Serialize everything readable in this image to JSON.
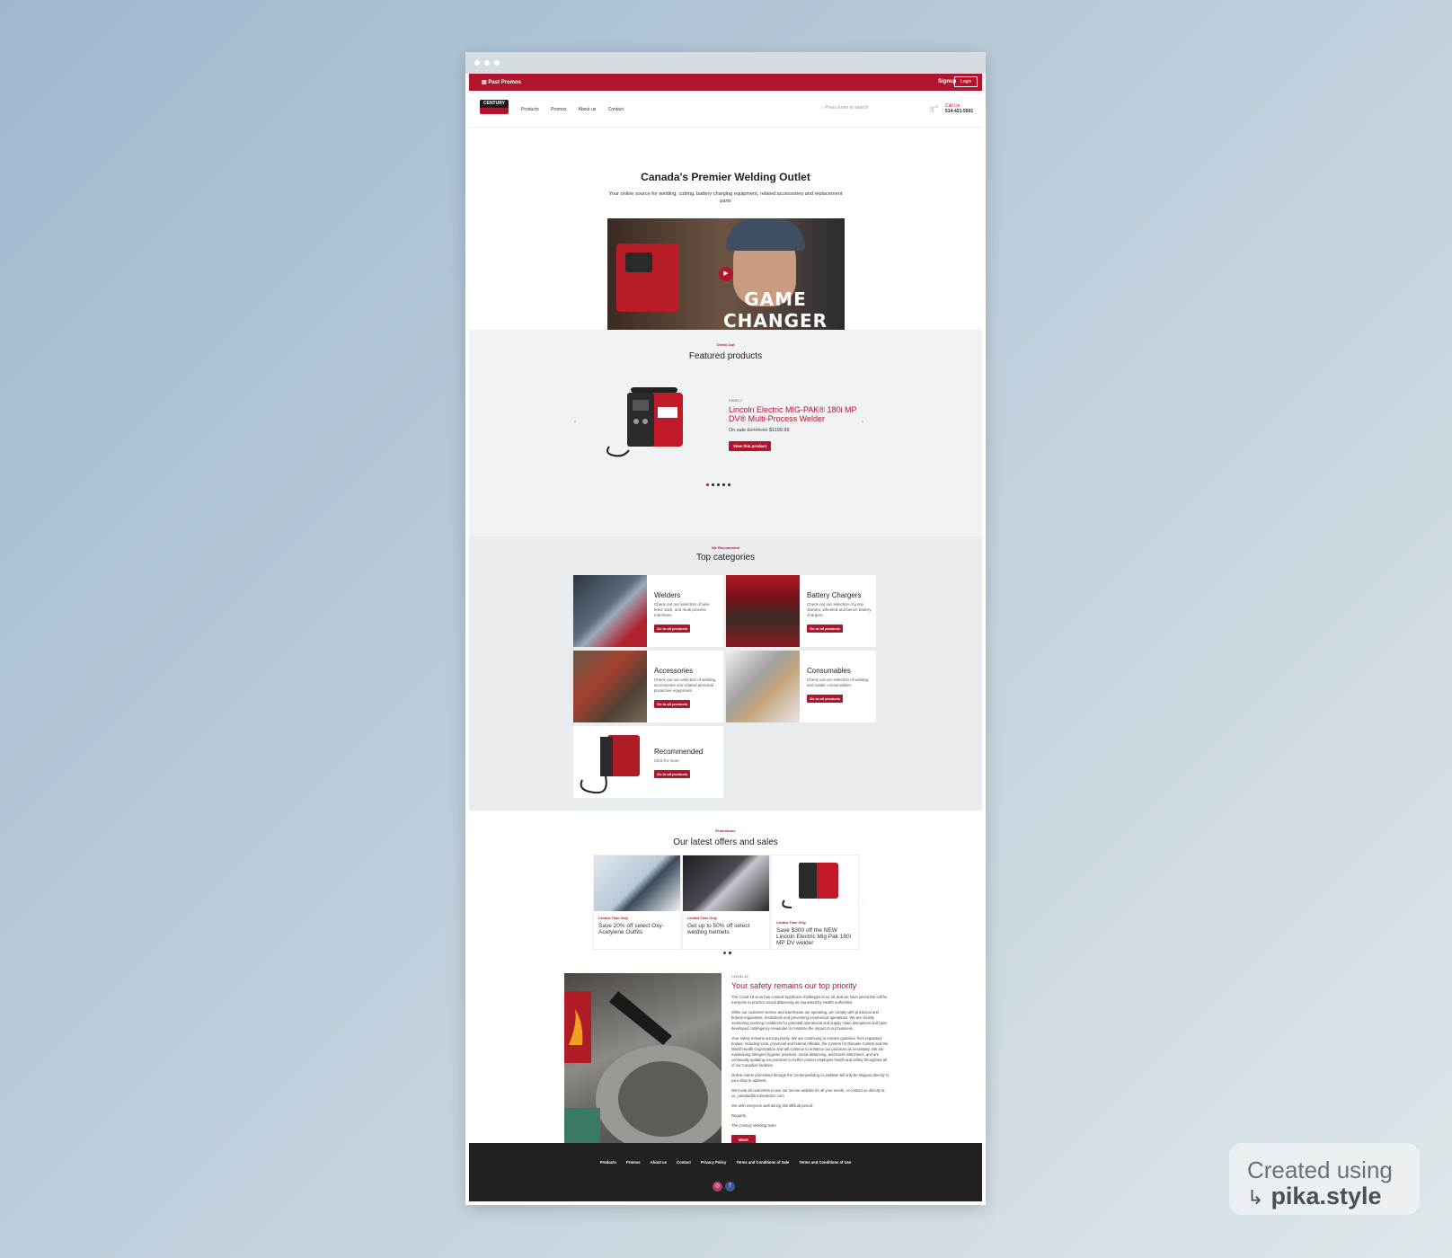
{
  "topbar": {
    "promo": "Past Promos",
    "signup": "Signup",
    "login": "Login"
  },
  "nav": {
    "links": [
      "Products",
      "Promos",
      "About us",
      "Contact"
    ],
    "search_placeholder": "Press Enter to search",
    "cart_count": "0",
    "phone_label": "Call Us",
    "phone_number": "514-421-5501",
    "logo_text": "CENTURY"
  },
  "hero": {
    "title": "Canada's Premier Welding Outlet",
    "subtitle": "Your online source for welding, cutting, battery charging equipment, related accessories and replacement parts",
    "video_caption": "GAME CHANGER"
  },
  "featured": {
    "eyebrow": "Check Out",
    "title": "Featured products",
    "product": {
      "sku": "K5280-1",
      "name": "Lincoln Electric MIG-PAK® 180i MP DV® Multi-Process Welder",
      "on_sale": "On sale",
      "old_price": "$1499.99",
      "price": "$1199.99",
      "button": "View this product"
    }
  },
  "categories": {
    "eyebrow": "We Recommend",
    "title": "Top categories",
    "items": [
      {
        "title": "Welders",
        "desc": "Check out our selection of wire feed, stick, and multi process machines.",
        "button": "Go to all products"
      },
      {
        "title": "Battery Chargers",
        "desc": "Check out our selection of jump starters, wheeled and bench battery chargers.",
        "button": "Go to all products"
      },
      {
        "title": "Accessories",
        "desc": "Check out our selection of welding accessories and related personal protective equipment.",
        "button": "Go to all products"
      },
      {
        "title": "Consumables",
        "desc": "Check out our selection of welding and solder consumables.",
        "button": "Go to all products"
      },
      {
        "title": "Recommended",
        "desc": "Click for more",
        "button": "Go to all products"
      }
    ]
  },
  "offers": {
    "eyebrow": "Promotions",
    "title": "Our latest offers and sales",
    "items": [
      {
        "tag": "Limited Time Only",
        "title": "Save 20% off select Oxy-Acetylene Outfits"
      },
      {
        "tag": "Limited Time Only",
        "title": "Get up to 50% off select welding helmets"
      },
      {
        "tag": "Limited Time Only",
        "title": "Save $300 off the NEW Lincoln Electric Mig Pak 180i MP DV welder"
      }
    ]
  },
  "safety": {
    "eyebrow": "COVID-19",
    "title": "Your safety remains our top priority",
    "paragraphs": [
      "The Covid-19 virus has created significant challenges to us all, and we have joined the call for everyone to practice social distancing as requested by Health authorities.",
      "While our customer service and warehouse are operating, we comply with provincial and federal regulations, restrictions and preventing commercial operations. We are closely monitoring evolving conditions for potential operational and supply chain disruptions and have developed contingency measures to minimize the impact to our business.",
      "Your safety remains our top priority. We are continuing to monitor guidance from regulatory bodies, including local, provincial and federal officials, the Centers for Disease Control and the World Health Organization and will continue to enhance our practices as necessary. We are maintaining stringent hygiene practices, social distancing, and travel restrictions, and are continually updating our practices to further protect employee health and safety throughout all of our Canadian facilities.",
      "Online orders processed through the Centurywelding.ca website will only be shipped directly to your drop to address.",
      "We invite all customers to use our secure website for all your needs, or contact us directly at cs_canada@lincolnelectric.com",
      "We wish everyone well during this difficult period.",
      "Regards,",
      "The Century Welding team"
    ],
    "button": "More"
  },
  "footer": {
    "links": [
      "Products",
      "Promos",
      "About us",
      "Contact",
      "Privacy Policy",
      "Terms and Conditions of Sale",
      "Terms and Conditions of Use"
    ]
  },
  "badge": {
    "line1": "Created using",
    "line2": "pika.style"
  },
  "colors": {
    "brand": "#b0152e",
    "footer": "#222222",
    "section_bg": "#e9ecef"
  }
}
